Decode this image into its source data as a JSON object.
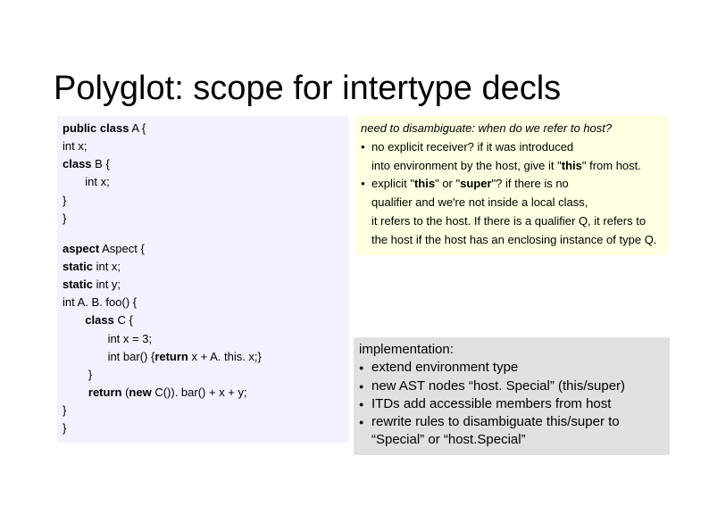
{
  "title": "Polyglot: scope for intertype decls",
  "code": {
    "l1a": "public class",
    "l1b": " A {",
    "l2": "int x;",
    "l3a": "class",
    "l3b": " B {",
    "l4": "       int x;",
    "l5": "}",
    "l6": "}",
    "l7a": "aspect",
    "l7b": " Aspect {",
    "l8a": "static ",
    "l8b": "int x;",
    "l9a": "static ",
    "l9b": "int y;",
    "l10": "int A. B. foo() {",
    "l11a": "       class",
    "l11b": " C {",
    "l12": "              int x = 3;",
    "l13a": "              int bar() {",
    "l13b": "return",
    "l13c": " x + A. this. x;}",
    "l14": "        }",
    "l15a": "        return ",
    "l15b": "(",
    "l15c": "new",
    "l15d": " C()). bar() + x + y;",
    "l16": "}",
    "l17": "}"
  },
  "note": {
    "title": "need to disambiguate: when do we refer to host?",
    "b1_l1": "no explicit receiver? if it was introduced",
    "b1_l2": "into environment by the host, give it \"",
    "b1_this": "this",
    "b1_l2b": "\" from host.",
    "b2_l1a": "explicit \"",
    "b2_this": "this",
    "b2_l1b": "\" or \"",
    "b2_super": "super",
    "b2_l1c": "\"? if there is no",
    "b2_l2": "qualifier and we're not inside a local class,",
    "b2_l3": "it refers to the host. If there is a qualifier Q, it refers to",
    "b2_l4": "the host if the host has an enclosing instance of type Q."
  },
  "impl": {
    "title": "implementation:",
    "i1": "extend environment type",
    "i2": "new AST nodes “host. Special” (this/super)",
    "i3": "ITDs add accessible members from host",
    "i4": "rewrite rules to disambiguate this/super to “Special” or “host.Special”"
  }
}
